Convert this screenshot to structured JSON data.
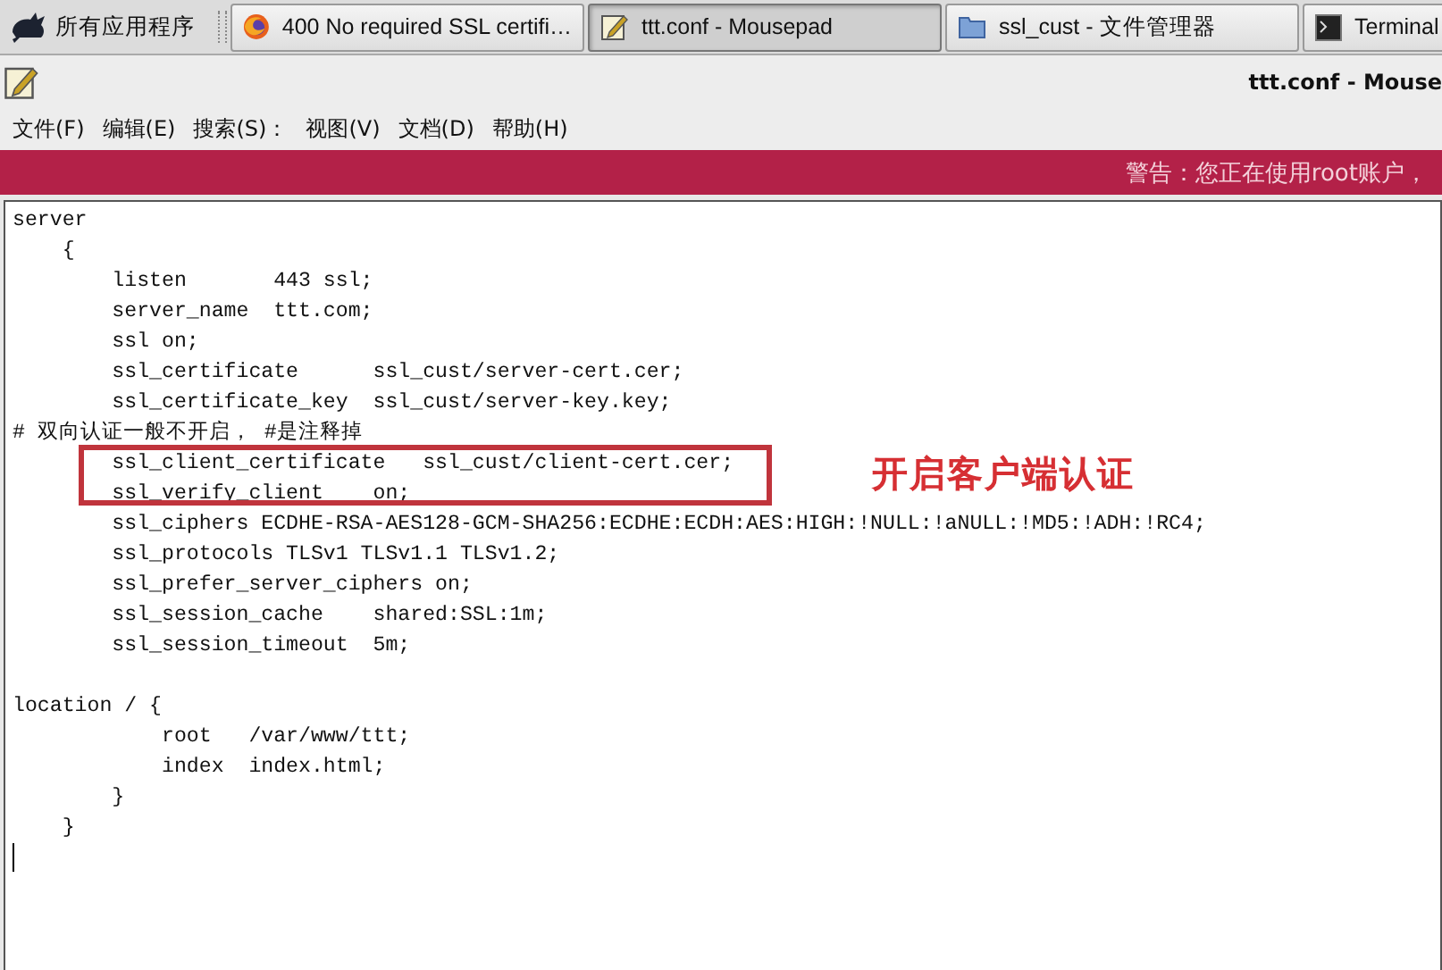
{
  "taskbar": {
    "apps_menu": "所有应用程序",
    "tasks": [
      {
        "label": "400 No required SSL certifi…",
        "kind": "browser",
        "selected": false
      },
      {
        "label": "ttt.conf - Mousepad",
        "kind": "editor",
        "selected": true
      },
      {
        "label": "ssl_cust - 文件管理器",
        "kind": "folder",
        "selected": false
      },
      {
        "label": "Terminal",
        "kind": "terminal",
        "selected": false
      }
    ]
  },
  "window": {
    "title": "ttt.conf - Mouse"
  },
  "menu": [
    "文件(F)",
    "编辑(E)",
    "搜索(S)：",
    "视图(V)",
    "文档(D)",
    "帮助(H)"
  ],
  "warning": "警告：您正在使用root账户，",
  "editor": {
    "lines": [
      {
        "text": "server",
        "boxed": false
      },
      {
        "text": "    {",
        "boxed": false
      },
      {
        "text": "        listen       443 ssl;",
        "boxed": false
      },
      {
        "text": "        server_name  ttt.com;",
        "boxed": false
      },
      {
        "text": "        ssl on;",
        "boxed": false
      },
      {
        "text": "        ssl_certificate      ssl_cust/server-cert.cer;",
        "boxed": false
      },
      {
        "text": "        ssl_certificate_key  ssl_cust/server-key.key;",
        "boxed": false
      },
      {
        "text": "# 双向认证一般不开启， #是注释掉",
        "boxed": false
      },
      {
        "text": "        ssl_client_certificate   ssl_cust/client-cert.cer;",
        "boxed": true
      },
      {
        "text": "        ssl_verify_client    on;",
        "boxed": true
      },
      {
        "text": "        ssl_ciphers ECDHE-RSA-AES128-GCM-SHA256:ECDHE:ECDH:AES:HIGH:!NULL:!aNULL:!MD5:!ADH:!RC4;",
        "boxed": false
      },
      {
        "text": "        ssl_protocols TLSv1 TLSv1.1 TLSv1.2;",
        "boxed": false
      },
      {
        "text": "        ssl_prefer_server_ciphers on;",
        "boxed": false
      },
      {
        "text": "        ssl_session_cache    shared:SSL:1m;",
        "boxed": false
      },
      {
        "text": "        ssl_session_timeout  5m;",
        "boxed": false
      },
      {
        "kind": "blank"
      },
      {
        "text": "location / {",
        "boxed": false
      },
      {
        "text": "            root   /var/www/ttt;",
        "boxed": false
      },
      {
        "text": "            index  index.html;",
        "boxed": false
      },
      {
        "text": "        }",
        "boxed": false
      },
      {
        "text": "    }",
        "boxed": false
      }
    ],
    "annotation": "开启客户端认证"
  }
}
